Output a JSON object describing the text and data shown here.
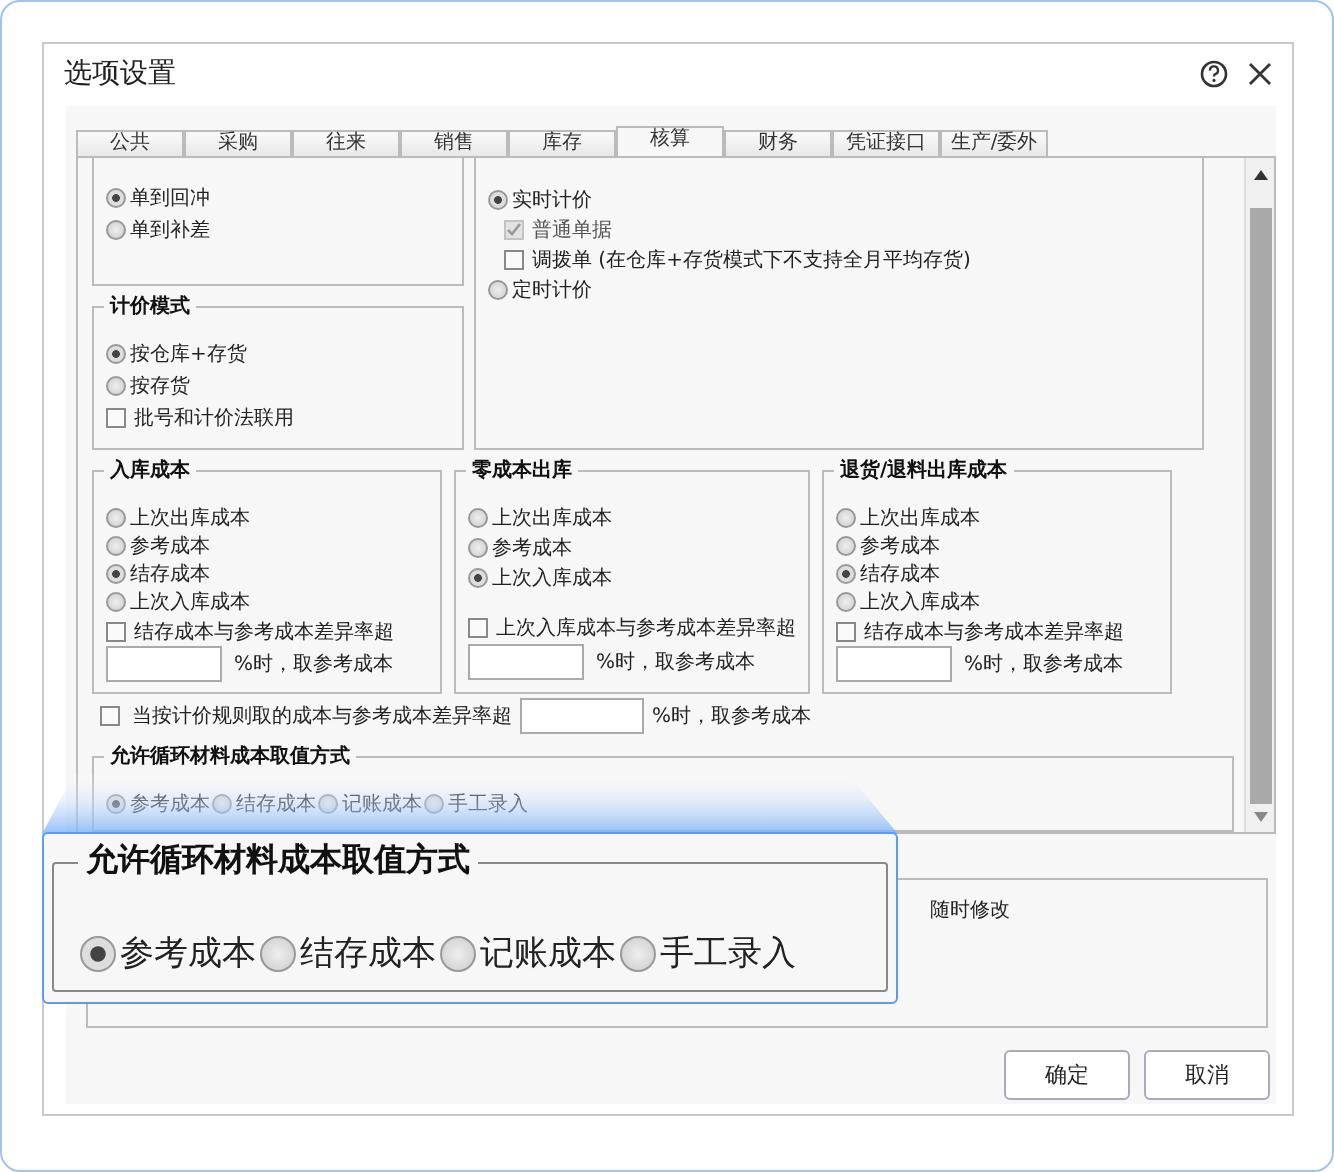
{
  "window": {
    "title": "选项设置"
  },
  "tabs": [
    {
      "label": "公共",
      "selected": false
    },
    {
      "label": "采购",
      "selected": false
    },
    {
      "label": "往来",
      "selected": false
    },
    {
      "label": "销售",
      "selected": false
    },
    {
      "label": "库存",
      "selected": false
    },
    {
      "label": "核算",
      "selected": true
    },
    {
      "label": "财务",
      "selected": false
    },
    {
      "label": "凭证接口",
      "selected": false
    },
    {
      "label": "生产/委外",
      "selected": false
    }
  ],
  "settle_group": {
    "options": [
      {
        "label": "单到回冲",
        "selected": true
      },
      {
        "label": "单到补差",
        "selected": false
      }
    ]
  },
  "costing_group": {
    "options": [
      {
        "kind": "radio",
        "label": "实时计价",
        "selected": true
      },
      {
        "kind": "checkbox",
        "label": "普通单据",
        "checked": true,
        "disabled": true
      },
      {
        "kind": "checkbox",
        "label": "调拨单 (在仓库+存货模式下不支持全月平均存货)",
        "checked": false,
        "disabled": false
      },
      {
        "kind": "radio",
        "label": "定时计价",
        "selected": false
      }
    ]
  },
  "pricing_mode": {
    "title": "计价模式",
    "options": [
      {
        "kind": "radio",
        "label": "按仓库+存货",
        "selected": true
      },
      {
        "kind": "radio",
        "label": "按存货",
        "selected": false
      },
      {
        "kind": "checkbox",
        "label": "批号和计价法联用",
        "checked": false
      }
    ]
  },
  "cost_groups": [
    {
      "title": "入库成本",
      "options": [
        {
          "label": "上次出库成本",
          "selected": false
        },
        {
          "label": "参考成本",
          "selected": false
        },
        {
          "label": "结存成本",
          "selected": true
        },
        {
          "label": "上次入库成本",
          "selected": false
        }
      ],
      "check": {
        "label": "结存成本与参考成本差异率超",
        "checked": false
      },
      "suffix": "%时，取参考成本"
    },
    {
      "title": "零成本出库",
      "options": [
        {
          "label": "上次出库成本",
          "selected": false
        },
        {
          "label": "参考成本",
          "selected": false
        },
        {
          "label": "上次入库成本",
          "selected": true
        }
      ],
      "check": {
        "label": "上次入库成本与参考成本差异率超",
        "checked": false
      },
      "suffix": "%时，取参考成本"
    },
    {
      "title": "退货/退料出库成本",
      "options": [
        {
          "label": "上次出库成本",
          "selected": false
        },
        {
          "label": "参考成本",
          "selected": false
        },
        {
          "label": "结存成本",
          "selected": true
        },
        {
          "label": "上次入库成本",
          "selected": false
        }
      ],
      "check": {
        "label": "结存成本与参考成本差异率超",
        "checked": false
      },
      "suffix": "%时，取参考成本"
    }
  ],
  "threshold": {
    "label": "当按计价规则取的成本与参考成本差异率超",
    "checked": false,
    "suffix": "%时，取参考成本"
  },
  "cycle_group": {
    "title": "允许循环材料成本取值方式",
    "options": [
      {
        "label": "参考成本",
        "selected": true
      },
      {
        "label": "结存成本",
        "selected": false
      },
      {
        "label": "记账成本",
        "selected": false
      },
      {
        "label": "手工录入",
        "selected": false
      }
    ]
  },
  "notes": {
    "text": "随时修改"
  },
  "callout": {
    "title": "允许循环材料成本取值方式",
    "options": [
      {
        "label": "参考成本",
        "selected": true
      },
      {
        "label": "结存成本",
        "selected": false
      },
      {
        "label": "记账成本",
        "selected": false
      },
      {
        "label": "手工录入",
        "selected": false
      }
    ]
  },
  "buttons": [
    "确定",
    "取消"
  ]
}
